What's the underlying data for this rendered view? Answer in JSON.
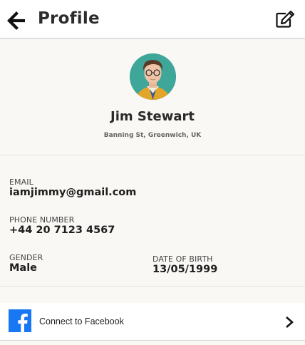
{
  "header": {
    "title": "Profile"
  },
  "profile": {
    "name": "Jim Stewart",
    "address": "Banning St, Greenwich, UK"
  },
  "info": {
    "email_label": "EMAIL",
    "email": "iamjimmy@gmail.com",
    "phone_label": "PHONE NUMBER",
    "phone": "+44 20 7123 4567",
    "gender_label": "GENDER",
    "gender": "Male",
    "dob_label": "DATE OF BIRTH",
    "dob": "13/05/1999"
  },
  "social": {
    "facebook_label": "Connect to Facebook"
  },
  "icons": {
    "back": "arrow-left-icon",
    "edit": "edit-icon",
    "facebook": "facebook-logo",
    "chevron": "chevron-right-icon"
  },
  "colors": {
    "facebook_blue": "#1877f2",
    "avatar_bg": "#3fa79a",
    "page_bg": "#faf8f5"
  }
}
